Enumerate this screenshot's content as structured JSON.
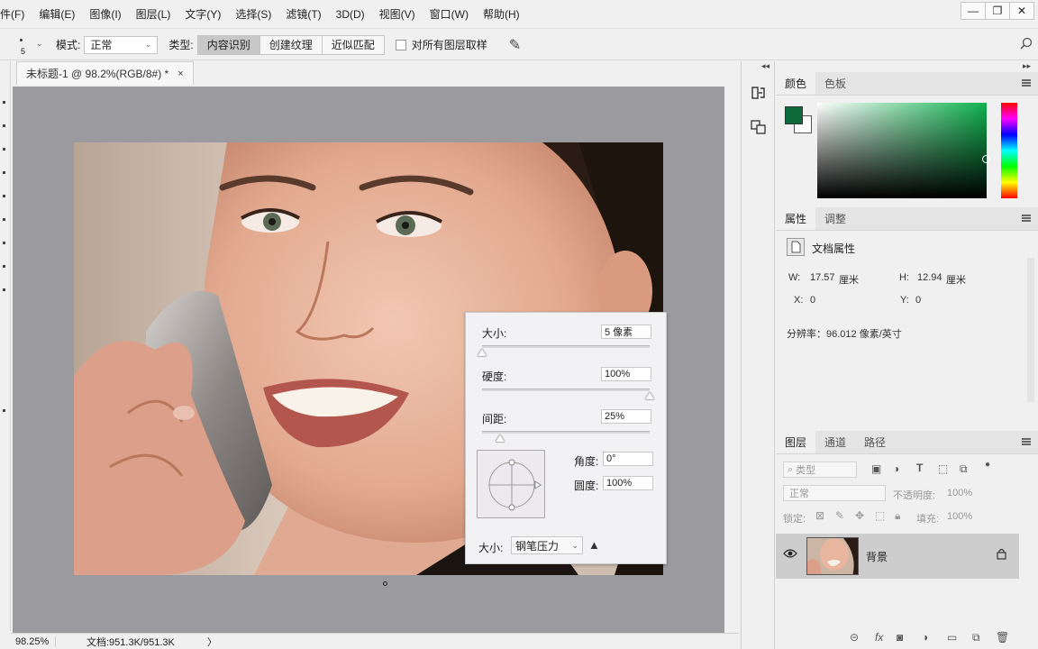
{
  "menu": [
    "件(F)",
    "编辑(E)",
    "图像(I)",
    "图层(L)",
    "文字(Y)",
    "选择(S)",
    "滤镜(T)",
    "3D(D)",
    "视图(V)",
    "窗口(W)",
    "帮助(H)"
  ],
  "window_controls": {
    "minimize": "—",
    "restore": "❐",
    "close": "✕"
  },
  "options": {
    "brush_size": "5",
    "mode_label": "模式:",
    "mode_value": "正常",
    "type_label": "类型:",
    "types": [
      "内容识别",
      "创建纹理",
      "近似匹配"
    ],
    "active_type": 0,
    "sample_all_label": "对所有图层取样"
  },
  "document": {
    "tab_title": "未标题-1 @ 98.2%(RGB/8#) *",
    "close": "×"
  },
  "status": {
    "zoom": "98.25%",
    "doc_info": "文档:951.3K/951.3K",
    "arrow": "〉"
  },
  "brush_popup": {
    "size_label": "大小:",
    "size_value": "5 像素",
    "size_slider": 0.0,
    "hardness_label": "硬度:",
    "hardness_value": "100%",
    "hardness_slider": 1.0,
    "spacing_label": "间距:",
    "spacing_value": "25%",
    "spacing_slider": 0.11,
    "angle_label": "角度:",
    "angle_value": "0°",
    "roundness_label": "圆度:",
    "roundness_value": "100%",
    "size_control_label": "大小:",
    "size_control_value": "钢笔压力"
  },
  "color_panel": {
    "tabs": [
      "颜色",
      "色板"
    ],
    "foreground": "#0e6a3a",
    "background": "#ffffff"
  },
  "properties_panel": {
    "tabs": [
      "属性",
      "调整"
    ],
    "title": "文档属性",
    "w_label": "W:",
    "w_value": "17.57",
    "w_unit": "厘米",
    "h_label": "H:",
    "h_value": "12.94",
    "h_unit": "厘米",
    "x_label": "X:",
    "x_value": "0",
    "y_label": "Y:",
    "y_value": "0",
    "resolution": "分辨率：96.012 像素/英寸"
  },
  "layers_panel": {
    "tabs": [
      "图层",
      "通道",
      "路径"
    ],
    "filter_label": "类型",
    "blend_mode": "正常",
    "opacity_label": "不透明度:",
    "opacity_value": "100%",
    "lock_label": "锁定:",
    "fill_label": "填充:",
    "fill_value": "100%",
    "layers": [
      {
        "name": "背景",
        "locked": true,
        "visible": true
      }
    ],
    "footer_icons": [
      "link-icon",
      "fx-icon",
      "mask-icon",
      "adjustment-icon",
      "folder-icon",
      "new-layer-icon",
      "trash-icon"
    ]
  }
}
